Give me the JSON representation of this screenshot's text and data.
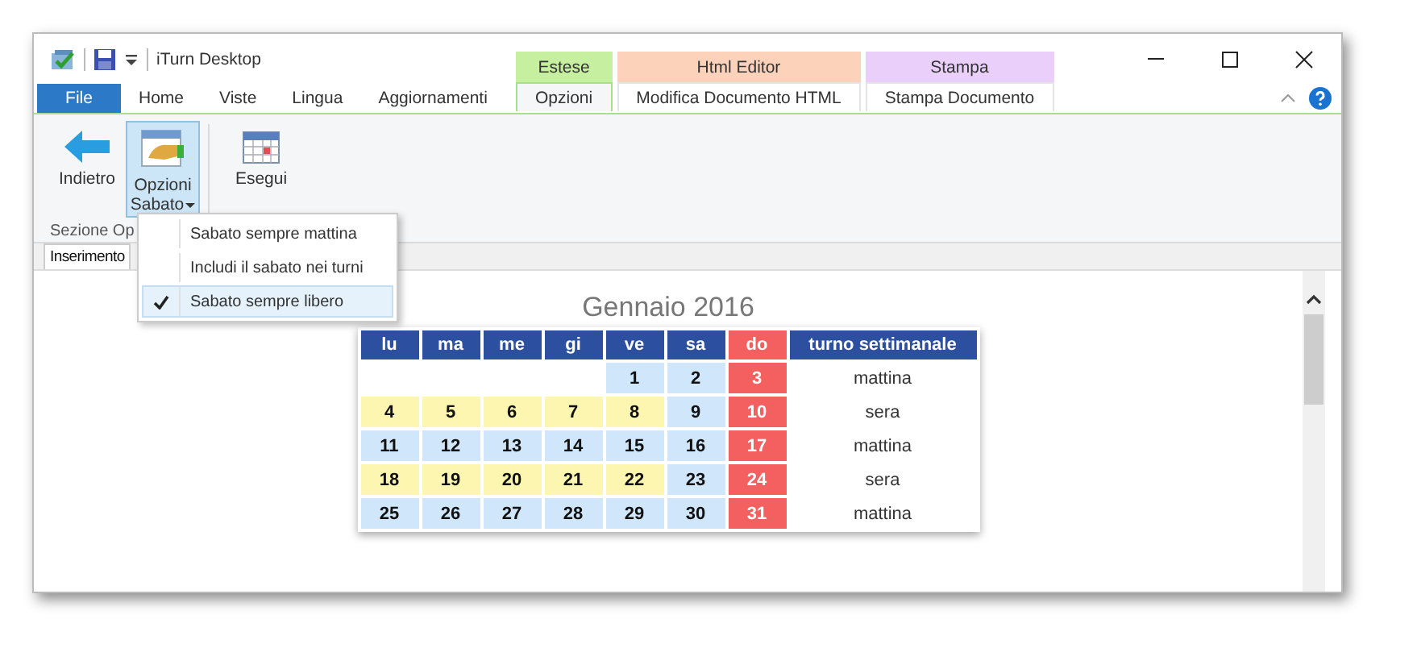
{
  "window": {
    "title": "iTurn Desktop"
  },
  "tabs": [
    {
      "label": "File",
      "kind": "file",
      "selected": false
    },
    {
      "label": "Home",
      "kind": "plain",
      "selected": false
    },
    {
      "label": "Viste",
      "kind": "plain",
      "selected": false
    },
    {
      "label": "Lingua",
      "kind": "plain",
      "selected": false
    },
    {
      "label": "Aggiornamenti",
      "kind": "plain",
      "selected": false
    }
  ],
  "context_groups": [
    {
      "label": "Estese",
      "color": "#c6efa0",
      "tabs": [
        {
          "label": "Opzioni",
          "selected": true
        }
      ]
    },
    {
      "label": "Html Editor",
      "color": "#fdd2bb",
      "tabs": [
        {
          "label": "Modifica Documento HTML",
          "selected": false
        }
      ]
    },
    {
      "label": "Stampa",
      "color": "#e9cffa",
      "tabs": [
        {
          "label": "Stampa Documento",
          "selected": false
        }
      ]
    }
  ],
  "ribbon": {
    "buttons": [
      {
        "label": "Indietro",
        "kind": "back",
        "pressed": false,
        "dropdown": false
      },
      {
        "label": "Opzioni Sabato",
        "kind": "options",
        "pressed": true,
        "dropdown": true
      },
      {
        "label": "Esegui",
        "kind": "run",
        "pressed": false,
        "dropdown": false
      }
    ],
    "group_label": "Sezione Op"
  },
  "menu": {
    "items": [
      {
        "label": "Sabato sempre mattina",
        "checked": false
      },
      {
        "label": "Includi il sabato nei turni",
        "checked": false
      },
      {
        "label": "Sabato sempre libero",
        "checked": true
      }
    ]
  },
  "doc_tabs": [
    {
      "label": "Inserimento",
      "selected": true
    }
  ],
  "calendar": {
    "title": "Gennaio 2016",
    "columns": [
      {
        "label": "lu",
        "kind": "day"
      },
      {
        "label": "ma",
        "kind": "day"
      },
      {
        "label": "me",
        "kind": "day"
      },
      {
        "label": "gi",
        "kind": "day"
      },
      {
        "label": "ve",
        "kind": "day"
      },
      {
        "label": "sa",
        "kind": "day"
      },
      {
        "label": "do",
        "kind": "sunday"
      },
      {
        "label": "turno settimanale",
        "kind": "shift"
      }
    ],
    "weeks": [
      {
        "days": [
          {
            "kind": "empty"
          },
          {
            "kind": "empty"
          },
          {
            "kind": "empty"
          },
          {
            "kind": "empty"
          },
          {
            "day": "1",
            "kind": "morning"
          },
          {
            "day": "2",
            "kind": "saturday"
          },
          {
            "day": "3",
            "kind": "sunday"
          }
        ],
        "shift": "mattina"
      },
      {
        "days": [
          {
            "day": "4",
            "kind": "evening"
          },
          {
            "day": "5",
            "kind": "evening"
          },
          {
            "day": "6",
            "kind": "evening"
          },
          {
            "day": "7",
            "kind": "evening"
          },
          {
            "day": "8",
            "kind": "evening"
          },
          {
            "day": "9",
            "kind": "saturday"
          },
          {
            "day": "10",
            "kind": "sunday"
          }
        ],
        "shift": "sera"
      },
      {
        "days": [
          {
            "day": "11",
            "kind": "morning"
          },
          {
            "day": "12",
            "kind": "morning"
          },
          {
            "day": "13",
            "kind": "morning"
          },
          {
            "day": "14",
            "kind": "morning"
          },
          {
            "day": "15",
            "kind": "morning"
          },
          {
            "day": "16",
            "kind": "saturday"
          },
          {
            "day": "17",
            "kind": "sunday"
          }
        ],
        "shift": "mattina"
      },
      {
        "days": [
          {
            "day": "18",
            "kind": "evening"
          },
          {
            "day": "19",
            "kind": "evening"
          },
          {
            "day": "20",
            "kind": "evening"
          },
          {
            "day": "21",
            "kind": "evening"
          },
          {
            "day": "22",
            "kind": "evening"
          },
          {
            "day": "23",
            "kind": "saturday"
          },
          {
            "day": "24",
            "kind": "sunday"
          }
        ],
        "shift": "sera"
      },
      {
        "days": [
          {
            "day": "25",
            "kind": "morning"
          },
          {
            "day": "26",
            "kind": "morning"
          },
          {
            "day": "27",
            "kind": "morning"
          },
          {
            "day": "28",
            "kind": "morning"
          },
          {
            "day": "29",
            "kind": "morning"
          },
          {
            "day": "30",
            "kind": "saturday"
          },
          {
            "day": "31",
            "kind": "sunday"
          }
        ],
        "shift": "mattina"
      }
    ]
  }
}
